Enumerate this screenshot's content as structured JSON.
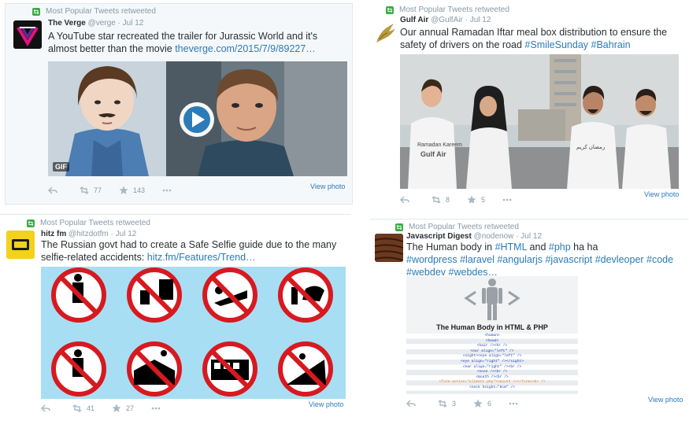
{
  "colors": {
    "retweet_green": "#3aad45",
    "link_blue": "#2b7bb9",
    "muted": "#8899a6"
  },
  "icons": [
    "retweet-context-icon",
    "reply-icon",
    "retweet-icon",
    "favorite-icon",
    "more-icon",
    "play-icon"
  ],
  "tweets": [
    {
      "context": "Most Popular Tweets retweeted",
      "name": "The Verge",
      "handle": "@verge",
      "dot": "·",
      "date": "Jul 12",
      "text_plain": "A YouTube star recreated the trailer for Jurassic World and it's almost better than the movie ",
      "link": "theverge.com/2015/7/9/89227…",
      "gif_badge": "GIF",
      "retweets": "77",
      "favorites": "143",
      "view_photo": "View photo"
    },
    {
      "context": "Most Popular Tweets retweeted",
      "name": "Gulf Air",
      "handle": "@GulfAir",
      "dot": "·",
      "date": "Jul 12",
      "text_plain": "Our annual Ramadan Iftar meal box distribution to ensure the safety of drivers on the road  ",
      "hashtag1": "#SmileSunday",
      "hashtag2": "#Bahrain",
      "shirt_text_ar": "رمضان كريم",
      "shirt_text_en": "Ramadan Kareem",
      "shirt_brand": "Gulf Air",
      "retweets": "8",
      "favorites": "5",
      "view_photo": "View photo"
    },
    {
      "context": "Most Popular Tweets retweeted",
      "name": "hitz fm",
      "handle": "@hitzdotfm",
      "dot": "·",
      "date": "Jul 12",
      "text_plain": "The Russian govt had to create a Safe Selfie guide due to the many selfie-related accidents: ",
      "link": "hitz.fm/Features/Trend…",
      "retweets": "41",
      "favorites": "27",
      "view_photo": "View photo"
    },
    {
      "context": "Most Popular Tweets retweeted",
      "name": "Javascript Digest",
      "handle": "@nodenow",
      "dot": "·",
      "date": "Jul 12",
      "text_prefix": "The Human body in ",
      "tag_html": "#HTML",
      "text_and": " and ",
      "tag_php": "#php",
      "text_suffix": " ha ha",
      "tags_line": "#wordpress #laravel #angularjs #javascript #devleoper #code #webdev #webdes…",
      "image_title": "The Human Body in HTML & PHP",
      "code_lines": [
        "<human>",
        "<head>",
        "<hair /><hr />",
        "<ear align=\"left\" />",
        "<sight><eye align=\"left\" />",
        "<eye align=\"right\" /></sight>",
        "<ear align=\"right\" /><br />",
        "<nose /><br />",
        "<mouth /><br />",
        "<form action=\"aliment.php\"><mouth /></form><br />",
        "<neck height=\"8cm\" />"
      ],
      "retweets": "3",
      "favorites": "6",
      "view_photo": "View photo"
    }
  ]
}
